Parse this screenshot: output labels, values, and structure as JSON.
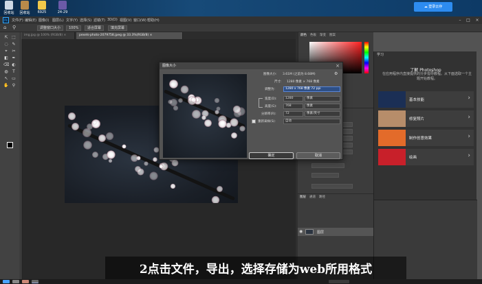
{
  "desktop": {
    "icons": [
      {
        "label": "回收站",
        "color": "#cfd8e3"
      },
      {
        "label": "回收站",
        "color": "#b98a4a"
      },
      {
        "label": "6925",
        "color": "#f1c84a"
      },
      {
        "label": "24-29",
        "color": "#6b5aa8"
      }
    ],
    "login_label": "☁ 登录云存"
  },
  "titlebar": {
    "logo": "Ps",
    "menus": [
      "文件(F)",
      "编辑(E)",
      "图像(I)",
      "图层(L)",
      "文字(Y)",
      "选择(S)",
      "滤镜(T)",
      "3D(D)",
      "视图(V)",
      "窗口(W)",
      "帮助(H)"
    ]
  },
  "options": {
    "buttons": [
      "调整窗口大小",
      "100%",
      "适合屏幕",
      "填充屏幕"
    ]
  },
  "tabs": [
    {
      "label": "img.jpg @ 100% (RGB/8) ×",
      "active": false
    },
    {
      "label": "pexels-photo-2079758.jpeg @ 33.3%(RGB/8) ×",
      "active": true
    }
  ],
  "statusbar": {
    "text": "33.33%   3000 像素 x 1608 像素 (72 ppi)"
  },
  "color_panel": {
    "tabs": [
      "颜色",
      "色板",
      "渐变",
      "图案"
    ]
  },
  "layers_panel": {
    "tabs": [
      "图层",
      "通道",
      "路径"
    ],
    "layer_name": "图层"
  },
  "learn": {
    "header": "学习",
    "title": "了解 Photoshop",
    "desc": "在应用程序内直接提供的分步指导教程。从下面选取一个主题开始教程。",
    "items": [
      {
        "label": "基本技能",
        "color": "#1b2f55"
      },
      {
        "label": "修复照片",
        "color": "#b78d6a"
      },
      {
        "label": "制作创意效果",
        "color": "#e36b2a"
      },
      {
        "label": "绘画",
        "color": "#c8202a"
      }
    ]
  },
  "dialog": {
    "title": "图像大小",
    "close": "×",
    "size_label": "图像大小:",
    "size_value": "3.61M (之前为 8.68M)",
    "dims_label": "尺寸:",
    "dims_value": "1280 像素 × 768 像素",
    "fit_label": "调整为:",
    "fit_value": "1280 x 768 像素 72 ppi",
    "width_label": "宽度(D):",
    "width_value": "1280",
    "width_unit": "像素",
    "height_label": "高度(G):",
    "height_value": "768",
    "height_unit": "像素",
    "res_label": "分辨率(R):",
    "res_value": "72",
    "res_unit": "像素/英寸",
    "resample_label": "重新采样(S):",
    "resample_value": "自动",
    "ok": "确定",
    "cancel": "取消"
  },
  "subtitle": "2点击文件，导出，选择存储为web所用格式"
}
